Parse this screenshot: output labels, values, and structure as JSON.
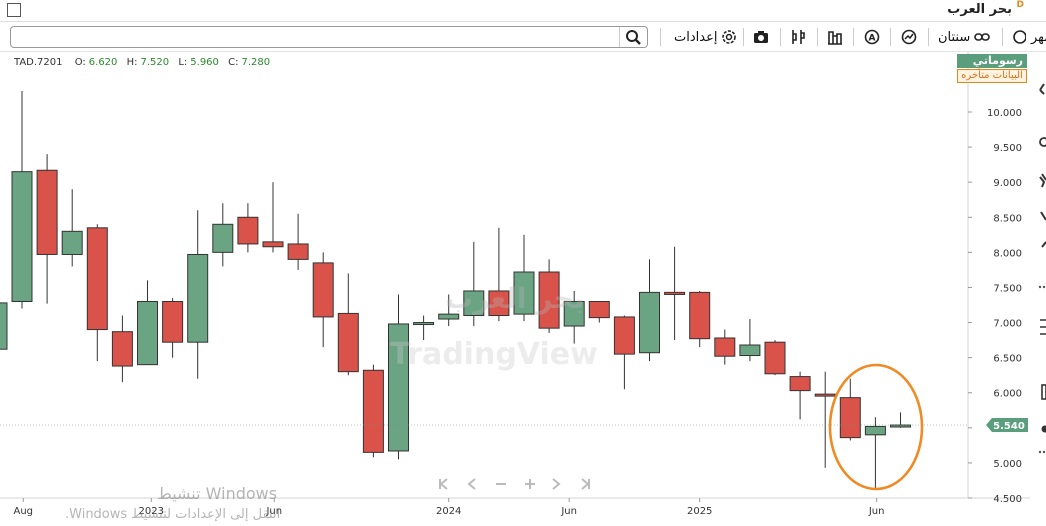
{
  "titlebar": {
    "title": "بحر العرب",
    "badge": "D"
  },
  "toolbar": {
    "search_placeholder": "",
    "items": {
      "month": "شهر",
      "two_years": "سنتان",
      "settings": "إعدادات"
    }
  },
  "legend": {
    "symbol": "TAD.7201",
    "o_label": "O:",
    "o_value": "6.620",
    "h_label": "H:",
    "h_value": "7.520",
    "l_label": "L:",
    "l_value": "5.960",
    "c_label": "C:",
    "c_value": "7.280"
  },
  "badges": {
    "user": "رسوماتي",
    "delayed": "البيانات متأخره"
  },
  "watermark": {
    "arabic": "بحر العرب",
    "brand": "TradingView"
  },
  "activation": {
    "line1": "تنشيط Windows",
    "line2": "انتقل إلى الإعدادات لتنشيط Windows."
  },
  "colors": {
    "up": "#6aa483",
    "down": "#d9534a",
    "price_label_bg": "#5a9e7e",
    "annotation": "#f08a24"
  },
  "chart_data": {
    "type": "candlestick",
    "price_label": "5.540",
    "y_ticks": [
      "10.000",
      "9.500",
      "9.000",
      "8.500",
      "8.000",
      "7.500",
      "7.000",
      "6.500",
      "6.000",
      "5.500",
      "5.000",
      "4.500"
    ],
    "ylim": [
      4.5,
      10.3
    ],
    "x_labels": [
      "Aug",
      "2023",
      "Jun",
      "2024",
      "Jun",
      "2025",
      "Jun"
    ],
    "candles": [
      {
        "o": 6.62,
        "h": 7.52,
        "l": 5.96,
        "c": 7.28
      },
      {
        "o": 7.3,
        "h": 10.3,
        "l": 7.2,
        "c": 9.15
      },
      {
        "o": 9.17,
        "h": 9.4,
        "l": 7.27,
        "c": 7.97
      },
      {
        "o": 7.97,
        "h": 8.9,
        "l": 7.8,
        "c": 8.3
      },
      {
        "o": 8.35,
        "h": 8.4,
        "l": 6.45,
        "c": 6.9
      },
      {
        "o": 6.87,
        "h": 7.1,
        "l": 6.15,
        "c": 6.38
      },
      {
        "o": 6.4,
        "h": 7.6,
        "l": 6.4,
        "c": 7.3
      },
      {
        "o": 7.3,
        "h": 7.35,
        "l": 6.5,
        "c": 6.72
      },
      {
        "o": 6.72,
        "h": 8.6,
        "l": 6.2,
        "c": 7.97
      },
      {
        "o": 8.0,
        "h": 8.7,
        "l": 7.8,
        "c": 8.4
      },
      {
        "o": 8.5,
        "h": 8.7,
        "l": 8.0,
        "c": 8.12
      },
      {
        "o": 8.15,
        "h": 9.0,
        "l": 8.0,
        "c": 8.08
      },
      {
        "o": 8.12,
        "h": 8.55,
        "l": 7.75,
        "c": 7.9
      },
      {
        "o": 7.85,
        "h": 8.0,
        "l": 6.65,
        "c": 7.08
      },
      {
        "o": 7.13,
        "h": 7.7,
        "l": 6.25,
        "c": 6.3
      },
      {
        "o": 6.32,
        "h": 6.4,
        "l": 5.08,
        "c": 5.15
      },
      {
        "o": 5.17,
        "h": 7.4,
        "l": 5.05,
        "c": 6.98
      },
      {
        "o": 7.0,
        "h": 7.1,
        "l": 6.75,
        "c": 7.0
      },
      {
        "o": 7.05,
        "h": 7.4,
        "l": 6.95,
        "c": 7.12
      },
      {
        "o": 7.1,
        "h": 8.15,
        "l": 6.95,
        "c": 7.45
      },
      {
        "o": 7.45,
        "h": 8.35,
        "l": 7.02,
        "c": 7.1
      },
      {
        "o": 7.12,
        "h": 8.25,
        "l": 7.02,
        "c": 7.72
      },
      {
        "o": 7.72,
        "h": 7.9,
        "l": 6.85,
        "c": 6.92
      },
      {
        "o": 6.95,
        "h": 7.45,
        "l": 6.7,
        "c": 7.3
      },
      {
        "o": 7.3,
        "h": 7.3,
        "l": 7.0,
        "c": 7.07
      },
      {
        "o": 7.08,
        "h": 7.1,
        "l": 6.05,
        "c": 6.55
      },
      {
        "o": 6.57,
        "h": 7.9,
        "l": 6.45,
        "c": 7.43
      },
      {
        "o": 7.43,
        "h": 8.08,
        "l": 6.75,
        "c": 7.4
      },
      {
        "o": 7.43,
        "h": 7.45,
        "l": 6.65,
        "c": 6.77
      },
      {
        "o": 6.78,
        "h": 6.9,
        "l": 6.4,
        "c": 6.52
      },
      {
        "o": 6.53,
        "h": 7.05,
        "l": 6.45,
        "c": 6.68
      },
      {
        "o": 6.72,
        "h": 6.75,
        "l": 6.25,
        "c": 6.27
      },
      {
        "o": 6.23,
        "h": 6.3,
        "l": 5.62,
        "c": 6.03
      },
      {
        "o": 5.98,
        "h": 6.3,
        "l": 4.93,
        "c": 5.96
      },
      {
        "o": 5.93,
        "h": 6.2,
        "l": 5.32,
        "c": 5.36
      },
      {
        "o": 5.4,
        "h": 5.65,
        "l": 4.64,
        "c": 5.52
      },
      {
        "o": 5.52,
        "h": 5.72,
        "l": 5.5,
        "c": 5.54
      }
    ]
  }
}
